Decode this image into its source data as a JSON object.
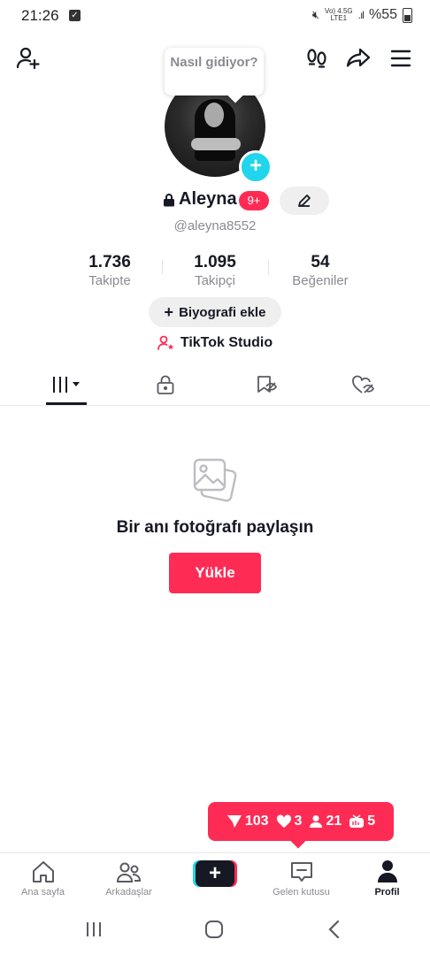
{
  "status_bar": {
    "time": "21:26",
    "network_top": "Vo) 4.5G",
    "network_bottom": "LTE1",
    "battery": "%55"
  },
  "header": {
    "bubble_text": "Nasıl gidiyor?"
  },
  "profile": {
    "name": "Aleyna",
    "notification_badge": "9+",
    "username": "@aleyna8552"
  },
  "stats": [
    {
      "value": "1.736",
      "label": "Takipte"
    },
    {
      "value": "1.095",
      "label": "Takipçi"
    },
    {
      "value": "54",
      "label": "Beğeniler"
    }
  ],
  "bio_button": "Biyografi ekle",
  "studio_link": "TikTok Studio",
  "empty_state": {
    "title": "Bir anı fotoğrafı paylaşın",
    "button": "Yükle"
  },
  "activity_toast": {
    "shares": "103",
    "likes": "3",
    "followers": "21",
    "views": "5"
  },
  "bottom_nav": [
    {
      "label": "Ana sayfa"
    },
    {
      "label": "Arkadaşlar"
    },
    {
      "label": ""
    },
    {
      "label": "Gelen kutusu"
    },
    {
      "label": "Profil"
    }
  ],
  "colors": {
    "accent": "#fe2c55",
    "cyan": "#20d5ec",
    "text": "#161823",
    "muted": "#8a8b91"
  }
}
